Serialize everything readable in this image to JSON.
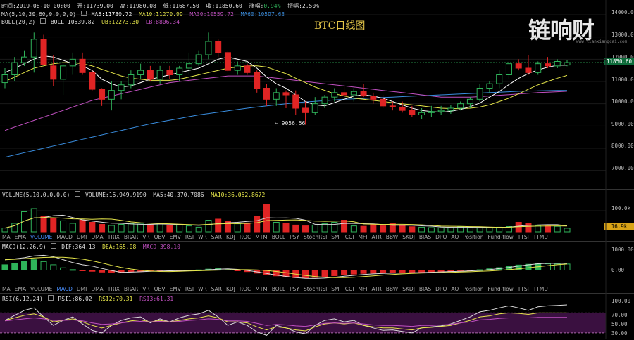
{
  "header": {
    "time_label": "时间:2019-08-10 00:00",
    "open_label": "开:11739.00",
    "high_label": "高:11980.08",
    "low_label": "低:11687.50",
    "close_label": "收:11850.60",
    "change_label": "涨幅:",
    "change_value": "0.94%",
    "amplitude_label": "振幅:2.50%"
  },
  "ma_legend": {
    "name": "MA(5,10,30,60,0,0,0,0)",
    "ma5": "MA5:11730.72",
    "ma10": "MA10:11270.99",
    "ma30": "MA30:10559.72",
    "ma60": "MA60:10597.63"
  },
  "boll_legend": {
    "name": "BOLL(20,2)",
    "boll": "BOLL:10539.82",
    "ub": "UB:12273.30",
    "lb": "LB:8806.34"
  },
  "title": "BTC日线图",
  "watermark": "链响财",
  "watermark_sub": "www.lianxiangcai.com",
  "low_annotation": "← 9056.56",
  "price_axis": [
    "14000.00",
    "13000.00",
    "12000.00",
    "11000.00",
    "10000.00",
    "9000.00",
    "8000.00",
    "7000.00"
  ],
  "current_price": "11850.60",
  "volume_legend": {
    "name": "VOLUME(5,10,0,0,0,0)",
    "volume": "VOLUME:16,949.9190",
    "ma5": "MA5:40,370.7086",
    "ma10": "MA10:36,052.8672"
  },
  "volume_axis": [
    "100.0k"
  ],
  "current_volume": "16.9k",
  "indicator_tabs_1": [
    "MA",
    "EMA",
    "VOLUME",
    "MACD",
    "DMI",
    "DMA",
    "TRIX",
    "BRAR",
    "VR",
    "OBV",
    "EMV",
    "RSI",
    "WR",
    "SAR",
    "KDJ",
    "ROC",
    "MTM",
    "BOLL",
    "PSY",
    "StochRSI",
    "SMI",
    "CCI",
    "MFI",
    "ATR",
    "BBW",
    "SKDJ",
    "BIAS",
    "DPO",
    "AO",
    "Position",
    "Fund-flow",
    "TTSI",
    "TTMU"
  ],
  "indicator_tabs_1_selected": "VOLUME",
  "macd_legend": {
    "name": "MACD(12,26,9)",
    "dif": "DIF:364.13",
    "dea": "DEA:165.08",
    "macd": "MACD:398.10"
  },
  "macd_axis": [
    "1000.00",
    "0.00"
  ],
  "indicator_tabs_2": [
    "MA",
    "EMA",
    "VOLUME",
    "MACD",
    "DMI",
    "DMA",
    "TRIX",
    "BRAR",
    "VR",
    "OBV",
    "EMV",
    "RSI",
    "WR",
    "SAR",
    "KDJ",
    "ROC",
    "MTM",
    "BOLL",
    "PSY",
    "StochRSI",
    "SMI",
    "CCI",
    "MFI",
    "ATR",
    "BBW",
    "SKDJ",
    "BIAS",
    "DPO",
    "AO",
    "Position",
    "Fund-flow",
    "TTSI",
    "TTMU"
  ],
  "indicator_tabs_2_selected": "MACD",
  "rsi_legend": {
    "name": "RSI(6,12,24)",
    "rsi1": "RSI1:86.02",
    "rsi2": "RSI2:70.31",
    "rsi3": "RSI3:61.31"
  },
  "rsi_axis": [
    "100.00",
    "70.00",
    "50.00",
    "30.00"
  ],
  "colors": {
    "up": "#2fb35a",
    "down": "#e02424",
    "ma5": "#ffffff",
    "ma10": "#e6e64a",
    "ma30": "#c050c0",
    "ma60": "#3a8ee0",
    "bg": "#000000"
  },
  "chart_data": [
    {
      "type": "candlestick",
      "title": "BTC日线图",
      "ylim": [
        6200,
        14600
      ],
      "ohlc": [
        [
          10950,
          11600,
          10700,
          11300
        ],
        [
          11300,
          12100,
          11000,
          11850
        ],
        [
          11850,
          12400,
          11700,
          12100
        ],
        [
          12100,
          13200,
          11400,
          12900
        ],
        [
          12900,
          13100,
          11800,
          11750
        ],
        [
          11700,
          12200,
          10800,
          11100
        ],
        [
          11100,
          11800,
          10400,
          11700
        ],
        [
          11700,
          12300,
          11300,
          12000
        ],
        [
          12000,
          12300,
          11300,
          11400
        ],
        [
          11400,
          11500,
          10600,
          10650
        ],
        [
          10650,
          10700,
          9900,
          10200
        ],
        [
          10200,
          11000,
          9700,
          10600
        ],
        [
          10600,
          11000,
          10200,
          10850
        ],
        [
          10850,
          11500,
          10700,
          11300
        ],
        [
          11300,
          11800,
          11100,
          11500
        ],
        [
          11500,
          11700,
          11000,
          11100
        ],
        [
          11100,
          11700,
          10900,
          11500
        ],
        [
          11500,
          11700,
          11100,
          11300
        ],
        [
          11300,
          11700,
          11000,
          11600
        ],
        [
          11600,
          12300,
          11300,
          11800
        ],
        [
          11800,
          12400,
          11700,
          12200
        ],
        [
          12200,
          13200,
          12000,
          12800
        ],
        [
          12800,
          12900,
          12100,
          12300
        ],
        [
          12300,
          12400,
          11400,
          11500
        ],
        [
          11500,
          11900,
          11300,
          11700
        ],
        [
          11700,
          11800,
          11300,
          11400
        ],
        [
          11400,
          11500,
          10500,
          10700
        ],
        [
          10700,
          10900,
          9900,
          10200
        ],
        [
          10200,
          10700,
          9900,
          10500
        ],
        [
          10500,
          10600,
          9800,
          10400
        ],
        [
          10400,
          10600,
          9500,
          9800
        ],
        [
          9800,
          10100,
          9056,
          9600
        ],
        [
          9600,
          10300,
          9500,
          10000
        ],
        [
          10000,
          10400,
          9800,
          10300
        ],
        [
          10300,
          10700,
          10100,
          10500
        ],
        [
          10500,
          10800,
          10300,
          10400
        ],
        [
          10400,
          10700,
          10100,
          10550
        ],
        [
          10550,
          10900,
          10300,
          10350
        ],
        [
          10350,
          10500,
          10000,
          10200
        ],
        [
          10200,
          10400,
          9800,
          9900
        ],
        [
          9900,
          10100,
          9700,
          9850
        ],
        [
          9850,
          10100,
          9600,
          9700
        ],
        [
          9700,
          9900,
          9400,
          9500
        ],
        [
          9500,
          9800,
          9300,
          9600
        ],
        [
          9600,
          9900,
          9400,
          9650
        ],
        [
          9650,
          9900,
          9500,
          9700
        ],
        [
          9700,
          9950,
          9550,
          9800
        ],
        [
          9800,
          10100,
          9700,
          10000
        ],
        [
          10000,
          10300,
          9800,
          10200
        ],
        [
          10200,
          10900,
          10100,
          10700
        ],
        [
          10700,
          11000,
          10500,
          10900
        ],
        [
          10900,
          11500,
          10700,
          11300
        ],
        [
          11300,
          11900,
          11100,
          11800
        ],
        [
          11800,
          12000,
          11500,
          11600
        ],
        [
          11600,
          12200,
          11300,
          11400
        ],
        [
          11400,
          11900,
          11300,
          11800
        ],
        [
          11800,
          12100,
          11600,
          11700
        ],
        [
          11700,
          12000,
          11600,
          11900
        ],
        [
          11739,
          11980,
          11687,
          11850
        ]
      ],
      "ma5": [
        11400,
        11600,
        11800,
        12000,
        12150,
        12100,
        11950,
        11800,
        11700,
        11500,
        11100,
        10900,
        10750,
        10800,
        10950,
        11100,
        11200,
        11300,
        11400,
        11500,
        11600,
        11800,
        12000,
        12100,
        12000,
        11900,
        11600,
        11200,
        10900,
        10700,
        10400,
        10100,
        9950,
        9900,
        10050,
        10200,
        10350,
        10400,
        10350,
        10250,
        10100,
        9950,
        9800,
        9700,
        9650,
        9620,
        9660,
        9740,
        9870,
        10030,
        10300,
        10550,
        10860,
        11140,
        11360,
        11520,
        11640,
        11730,
        11730
      ],
      "ma10": [
        11000,
        11200,
        11400,
        11600,
        11700,
        11800,
        11850,
        11850,
        11800,
        11700,
        11550,
        11400,
        11250,
        11150,
        11100,
        11050,
        11050,
        11050,
        11100,
        11200,
        11300,
        11400,
        11500,
        11600,
        11650,
        11700,
        11700,
        11650,
        11500,
        11350,
        11150,
        10950,
        10750,
        10600,
        10450,
        10350,
        10250,
        10200,
        10150,
        10100,
        10050,
        10000,
        9950,
        9900,
        9850,
        9800,
        9780,
        9780,
        9800,
        9850,
        9950,
        10100,
        10250,
        10450,
        10650,
        10850,
        11000,
        11150,
        11270
      ],
      "ma30": [
        8800,
        8950,
        9100,
        9250,
        9400,
        9550,
        9700,
        9850,
        10000,
        10150,
        10250,
        10350,
        10450,
        10550,
        10650,
        10750,
        10850,
        10950,
        11000,
        11050,
        11100,
        11150,
        11200,
        11250,
        11250,
        11250,
        11250,
        11200,
        11150,
        11100,
        11050,
        11000,
        10950,
        10900,
        10850,
        10800,
        10750,
        10700,
        10650,
        10600,
        10550,
        10500,
        10450,
        10400,
        10350,
        10300,
        10300,
        10300,
        10300,
        10320,
        10350,
        10380,
        10410,
        10440,
        10470,
        10500,
        10520,
        10540,
        10560
      ],
      "ma60": [
        7600,
        7700,
        7800,
        7900,
        8000,
        8100,
        8200,
        8300,
        8400,
        8500,
        8600,
        8700,
        8800,
        8900,
        9000,
        9100,
        9180,
        9260,
        9340,
        9420,
        9500,
        9560,
        9620,
        9680,
        9740,
        9800,
        9850,
        9900,
        9950,
        10000,
        10050,
        10080,
        10110,
        10140,
        10170,
        10200,
        10220,
        10240,
        10260,
        10280,
        10300,
        10320,
        10340,
        10360,
        10380,
        10400,
        10420,
        10440,
        10460,
        10480,
        10500,
        10520,
        10540,
        10560,
        10570,
        10580,
        10590,
        10595,
        10598
      ]
    },
    {
      "type": "bar",
      "title": "VOLUME(5,10,0,0,0,0)",
      "ylim": [
        0,
        160000
      ],
      "values": [
        18000,
        40000,
        95000,
        110000,
        75000,
        62000,
        52000,
        40000,
        55000,
        45000,
        35000,
        30000,
        35000,
        40000,
        37000,
        33000,
        40000,
        30000,
        32000,
        28000,
        22000,
        55000,
        60000,
        50000,
        38000,
        42000,
        72000,
        130000,
        45000,
        40000,
        32000,
        28000,
        32000,
        38000,
        45000,
        55000,
        28000,
        26000,
        34000,
        28000,
        38000,
        30000,
        24000,
        22000,
        20000,
        19000,
        21000,
        24000,
        22000,
        20000,
        21000,
        22000,
        25000,
        45000,
        40000,
        30000,
        28000,
        26000,
        16949
      ]
    },
    {
      "type": "bar",
      "title": "MACD(12,26,9)",
      "ylim": [
        -900,
        1500
      ],
      "values": [
        350,
        450,
        600,
        680,
        560,
        350,
        150,
        30,
        -40,
        -80,
        -130,
        -140,
        -130,
        -100,
        -70,
        -60,
        -40,
        -30,
        -20,
        -10,
        10,
        60,
        90,
        60,
        -20,
        -100,
        -200,
        -300,
        -380,
        -450,
        -500,
        -520,
        -480,
        -430,
        -370,
        -310,
        -260,
        -220,
        -200,
        -180,
        -170,
        -160,
        -150,
        -130,
        -110,
        -90,
        -70,
        -50,
        -20,
        20,
        80,
        160,
        240,
        330,
        380,
        420,
        410,
        400,
        398
      ]
    },
    {
      "type": "line",
      "title": "RSI(6,12,24)",
      "ylim": [
        20,
        100
      ],
      "series": [
        {
          "name": "RSI1",
          "values": [
            55,
            65,
            75,
            80,
            62,
            45,
            55,
            62,
            48,
            35,
            30,
            45,
            55,
            60,
            62,
            50,
            58,
            52,
            60,
            65,
            68,
            75,
            62,
            45,
            52,
            45,
            32,
            25,
            45,
            40,
            32,
            28,
            45,
            55,
            58,
            52,
            55,
            45,
            40,
            35,
            36,
            33,
            30,
            40,
            42,
            44,
            48,
            55,
            62,
            72,
            75,
            80,
            84,
            80,
            75,
            82,
            84,
            85,
            86
          ]
        },
        {
          "name": "RSI2",
          "values": [
            55,
            60,
            65,
            68,
            62,
            52,
            55,
            58,
            52,
            45,
            40,
            45,
            50,
            54,
            56,
            52,
            55,
            52,
            55,
            58,
            60,
            64,
            60,
            52,
            52,
            50,
            42,
            36,
            42,
            40,
            36,
            34,
            42,
            48,
            50,
            48,
            50,
            45,
            42,
            40,
            40,
            38,
            36,
            40,
            41,
            43,
            45,
            50,
            55,
            62,
            64,
            68,
            70,
            69,
            67,
            70,
            70,
            70,
            70
          ]
        },
        {
          "name": "RSI3",
          "values": [
            54,
            56,
            58,
            60,
            58,
            55,
            55,
            56,
            54,
            50,
            47,
            48,
            50,
            52,
            53,
            52,
            53,
            52,
            53,
            55,
            56,
            58,
            57,
            54,
            54,
            53,
            49,
            45,
            47,
            46,
            44,
            43,
            46,
            49,
            50,
            49,
            50,
            48,
            46,
            45,
            45,
            44,
            43,
            45,
            45,
            46,
            47,
            50,
            52,
            56,
            57,
            59,
            60,
            60,
            60,
            61,
            61,
            61,
            61
          ]
        }
      ]
    }
  ]
}
